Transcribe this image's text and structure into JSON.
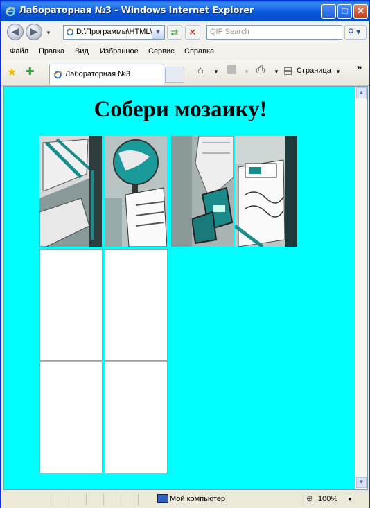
{
  "window": {
    "title": "Лабораторная №3 - Windows Internet Explorer",
    "controls": {
      "minimize": "_",
      "maximize": "□",
      "close": "✕"
    }
  },
  "address_bar": {
    "url": "D:\\Программы\\HTML\\",
    "search_placeholder": "QIP Search"
  },
  "menu": [
    "Файл",
    "Правка",
    "Вид",
    "Избранное",
    "Сервис",
    "Справка"
  ],
  "toolbar": {
    "tab_title": "Лабораторная №3",
    "page_menu": "Страница",
    "more": "»"
  },
  "page": {
    "heading": "Собери мозаику!",
    "pieces": [
      {
        "name": "puzzle-piece-1"
      },
      {
        "name": "puzzle-piece-2"
      },
      {
        "name": "puzzle-piece-3"
      },
      {
        "name": "puzzle-piece-4"
      }
    ],
    "board_cells": 4
  },
  "status_bar": {
    "zone": "Мой компьютер",
    "zoom": "100%"
  },
  "colors": {
    "page_background": "#00ffff",
    "title_bar": "#0a58dc",
    "teal_accent": "#1a8a8a"
  },
  "icons": [
    "ie-icon",
    "back-icon",
    "forward-icon",
    "refresh-icon",
    "stop-icon",
    "search-icon",
    "favorites-star-icon",
    "add-favorites-icon",
    "home-icon",
    "rss-icon",
    "print-icon",
    "page-icon",
    "computer-icon",
    "zoom-icon"
  ]
}
